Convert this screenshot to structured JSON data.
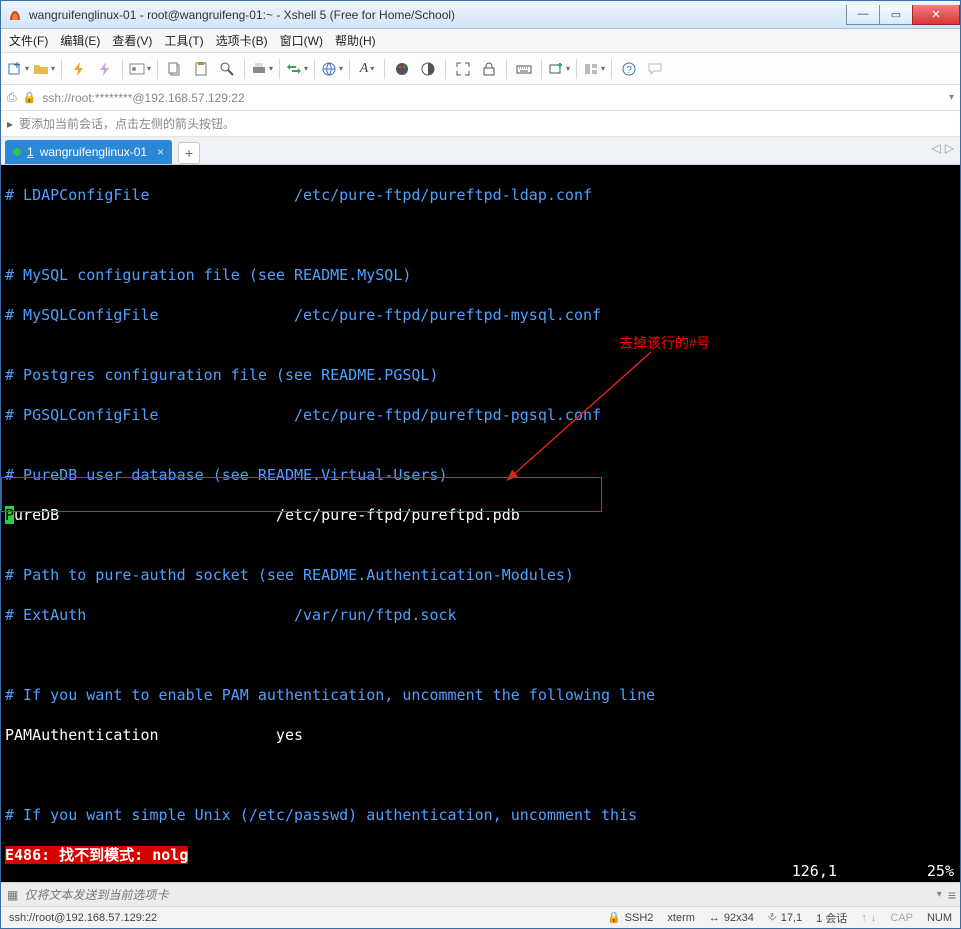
{
  "window": {
    "title": "wangruifenglinux-01 - root@wangruifeng-01:~ - Xshell 5 (Free for Home/School)"
  },
  "menu": {
    "file": "文件(F)",
    "edit": "编辑(E)",
    "view": "查看(V)",
    "tools": "工具(T)",
    "tabs": "选项卡(B)",
    "window": "窗口(W)",
    "help": "帮助(H)"
  },
  "address": {
    "text": "ssh://root:********@192.168.57.129:22"
  },
  "hintbar": {
    "text": "要添加当前会话，点击左侧的箭头按钮。"
  },
  "tab": {
    "num": "1",
    "label": "wangruifenglinux-01"
  },
  "terminal": {
    "l1": "# LDAPConfigFile                /etc/pure-ftpd/pureftpd-ldap.conf",
    "l2": "# MySQL configuration file (see README.MySQL)",
    "l3": "# MySQLConfigFile               /etc/pure-ftpd/pureftpd-mysql.conf",
    "l4": "# Postgres configuration file (see README.PGSQL)",
    "l5": "# PGSQLConfigFile               /etc/pure-ftpd/pureftpd-pgsql.conf",
    "l6": "# PureDB user database (see README.Virtual-Users)",
    "l7a": "P",
    "l7b": "ureDB                        /etc/pure-ftpd/pureftpd.pdb",
    "l8": "# Path to pure-authd socket (see README.Authentication-Modules)",
    "l9": "# ExtAuth                       /var/run/ftpd.sock",
    "l10": "# If you want to enable PAM authentication, uncomment the following line",
    "l11": "PAMAuthentication             yes",
    "l12": "# If you want simple Unix (/etc/passwd) authentication, uncomment this",
    "err": "E486: 找不到模式: nolg",
    "pos": "126,1",
    "pct": "25%"
  },
  "annotation": {
    "text": "去掉该行的#号"
  },
  "inputbar": {
    "placeholder": "仅将文本发送到当前选项卡"
  },
  "status": {
    "left": "ssh://root@192.168.57.129:22",
    "ssh": "SSH2",
    "term": "xterm",
    "size": "92x34",
    "rc": "17,1",
    "sess": "1 会话",
    "cap": "CAP",
    "num": "NUM"
  }
}
